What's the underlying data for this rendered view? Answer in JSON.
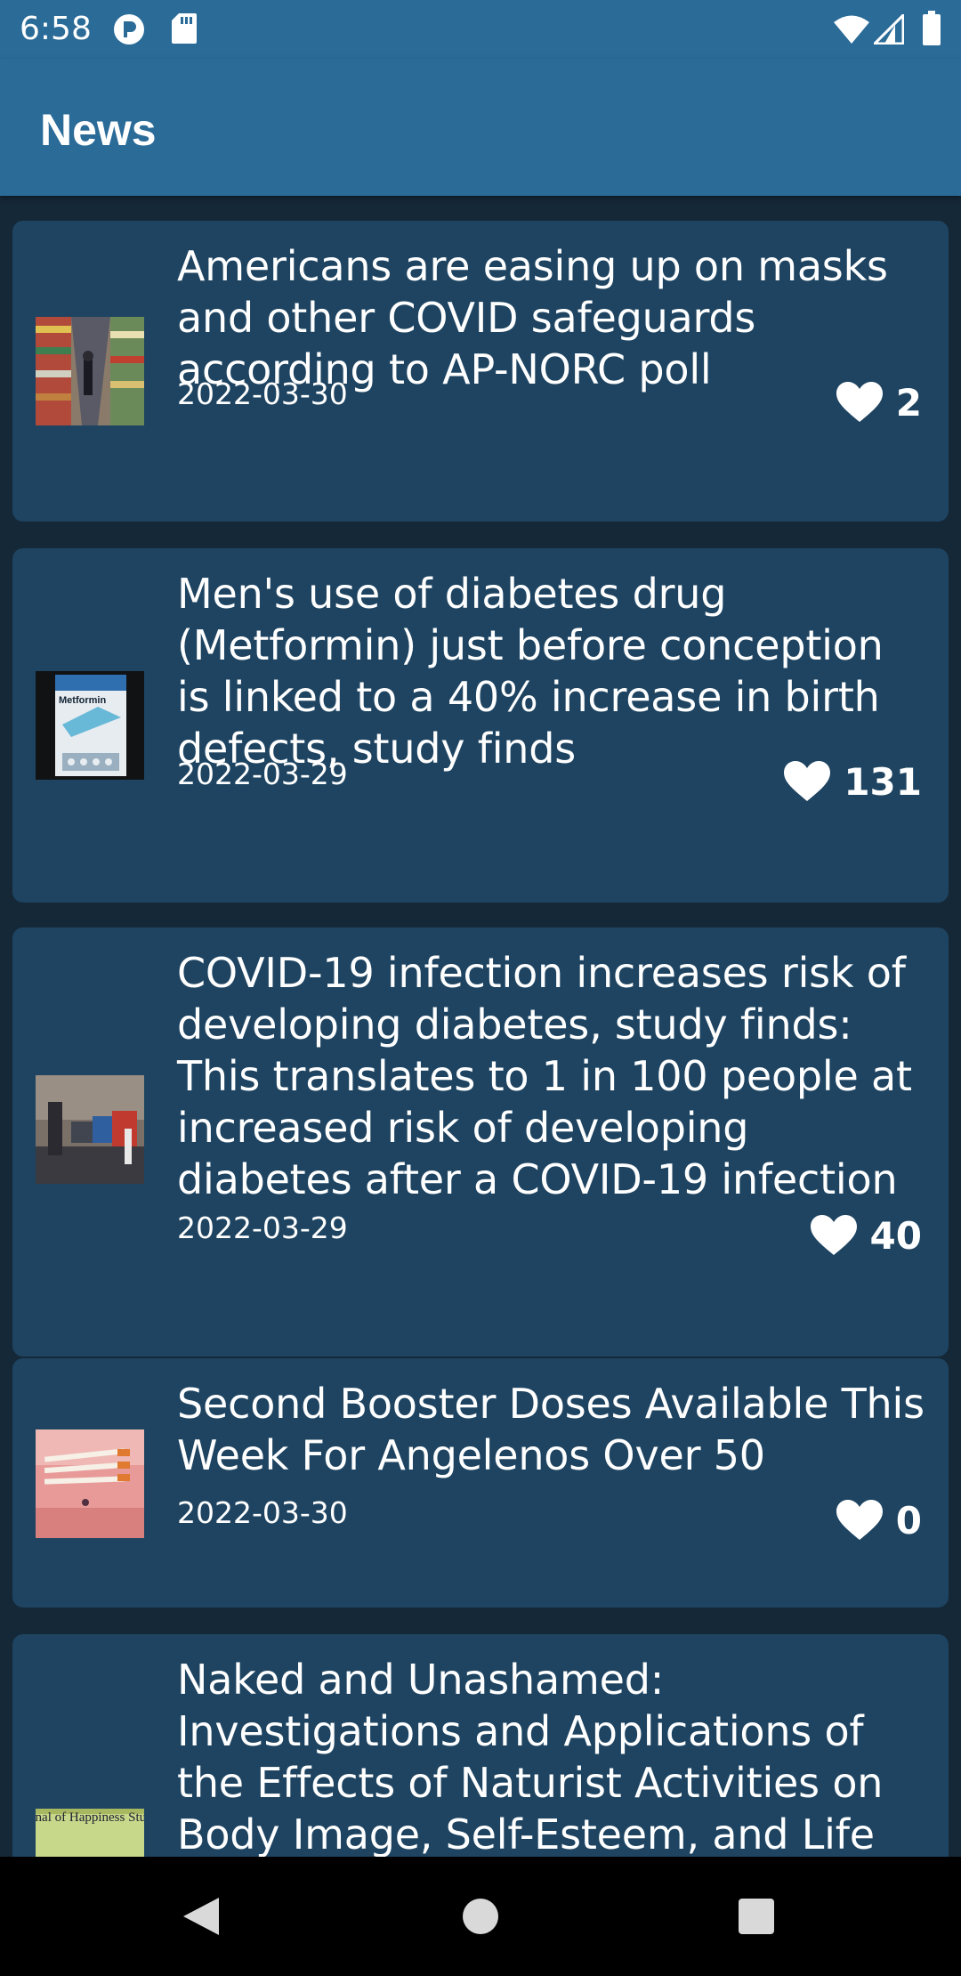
{
  "status_bar": {
    "time": "6:58",
    "icons": [
      "app-notification-icon",
      "sd-card-icon",
      "wifi-icon",
      "signal-icon",
      "battery-icon"
    ]
  },
  "app_bar": {
    "title": "News"
  },
  "news": [
    {
      "title": "Americans are easing up on masks and other COVID safeguards according to AP-NORC poll",
      "date": "2022-03-30",
      "likes": "2",
      "thumbnail": "grocery-store-aisle-image"
    },
    {
      "title": "Men's use of diabetes drug (Metformin) just before conception is linked to a 40% increase in birth defects, study finds",
      "date": "2022-03-29",
      "likes": "131",
      "thumbnail": "metformin-box-image",
      "thumbnail_text": "Metformin"
    },
    {
      "title": "COVID-19 infection increases risk of developing diabetes, study finds: This translates to 1 in 100 people at increased risk of developing diabetes after a COVID-19 infection",
      "date": "2022-03-29",
      "likes": "40",
      "thumbnail": "street-testing-site-image"
    },
    {
      "title": "Second Booster Doses Available This Week For Angelenos Over 50",
      "date": "2022-03-30",
      "likes": "0",
      "thumbnail": "syringes-image"
    },
    {
      "title": "Naked and Unashamed: Investigations and Applications of the Effects of Naturist Activities on Body Image, Self-Esteem, and Life",
      "date": "",
      "likes": "",
      "thumbnail": "journal-cover-image",
      "thumbnail_text": "Journal of Happiness Studies"
    }
  ],
  "nav_bar": {
    "buttons": [
      "back",
      "home",
      "recents"
    ]
  },
  "colors": {
    "app_bar": "#2a6b98",
    "background": "#152838",
    "card": "#1e4461",
    "text": "#ffffff"
  }
}
